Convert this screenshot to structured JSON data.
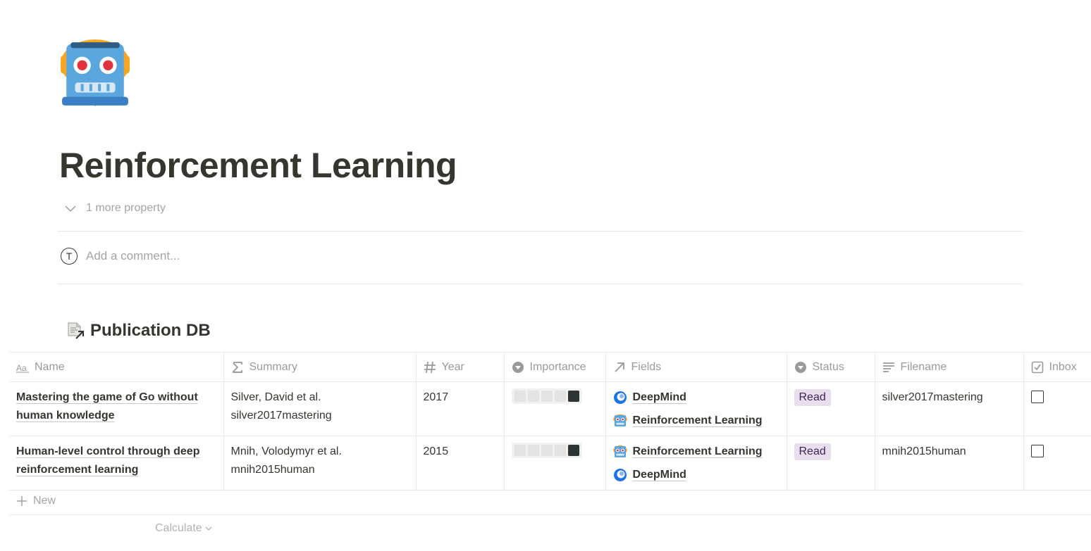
{
  "page": {
    "icon": "robot-face-icon",
    "title": "Reinforcement Learning",
    "more_property": "1 more property",
    "comment_avatar": "T",
    "comment_placeholder": "Add a comment..."
  },
  "database": {
    "title": "Publication DB",
    "icon": "linked-database-icon",
    "columns": [
      {
        "label": "Name",
        "icon": "title-aa-icon"
      },
      {
        "label": "Summary",
        "icon": "formula-sigma-icon"
      },
      {
        "label": "Year",
        "icon": "number-hash-icon"
      },
      {
        "label": "Importance",
        "icon": "select-icon"
      },
      {
        "label": "Fields",
        "icon": "relation-arrow-icon"
      },
      {
        "label": "Status",
        "icon": "select-icon"
      },
      {
        "label": "Filename",
        "icon": "text-lines-icon"
      },
      {
        "label": "Inbox",
        "icon": "checkbox-icon"
      }
    ],
    "rows": [
      {
        "name": "Mastering the game of Go without human knowledge",
        "summary_author": "Silver, David et al.",
        "summary_key": "silver2017mastering",
        "year": "2017",
        "importance": 5,
        "fields": [
          {
            "label": "DeepMind",
            "icon": "deepmind-icon"
          },
          {
            "label": "Reinforcement Learning",
            "icon": "robot-face-icon"
          }
        ],
        "status": "Read",
        "filename": "silver2017mastering",
        "inbox": false
      },
      {
        "name": "Human-level control through deep reinforcement learning",
        "summary_author": "Mnih, Volodymyr et al.",
        "summary_key": "mnih2015human",
        "year": "2015",
        "importance": 5,
        "fields": [
          {
            "label": "Reinforcement Learning",
            "icon": "robot-face-icon"
          },
          {
            "label": "DeepMind",
            "icon": "deepmind-icon"
          }
        ],
        "status": "Read",
        "filename": "mnih2015human",
        "inbox": false
      }
    ],
    "new_label": "New",
    "calculate_label": "Calculate"
  },
  "colors": {
    "text": "#37352f",
    "muted": "#9b9a97",
    "border": "#e9e9e7",
    "status_read_bg": "#e8deee",
    "status_read_text": "#412454",
    "importance_on": "#2f3437"
  }
}
